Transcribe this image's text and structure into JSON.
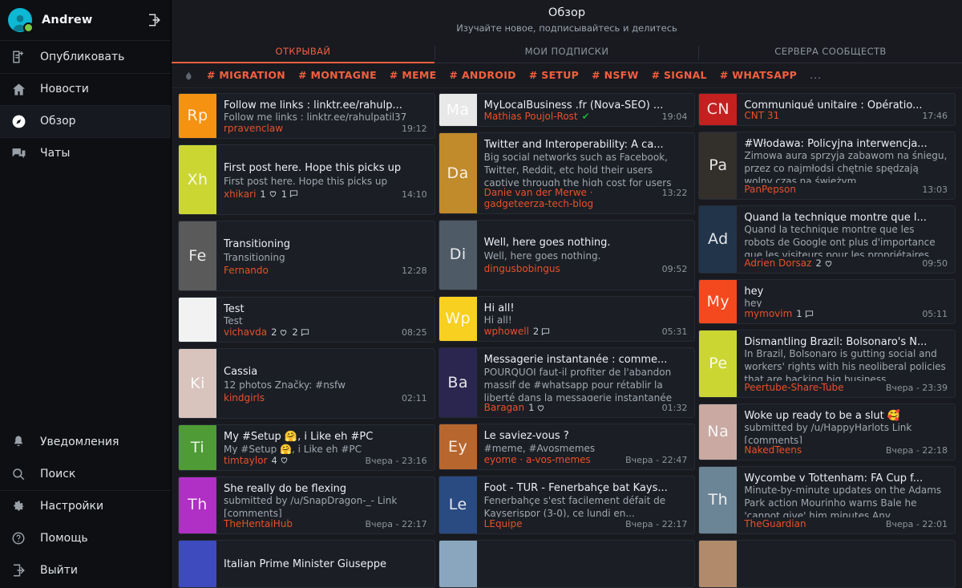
{
  "colors": {
    "accent": "#f4603e",
    "author": "#e8502a",
    "sidebar_bg": "#0d0f12",
    "card_bg": "#1b1e25",
    "verified": "#1ba83a"
  },
  "sidebar": {
    "user": {
      "name": "Andrew",
      "avatar_icon": "person-avatar",
      "status_icon": "online-dot",
      "logout_icon": "logout-icon"
    },
    "items_top": [
      {
        "label": "Опубликовать",
        "icon": "compose-icon",
        "active": false
      },
      {
        "label": "Новости",
        "icon": "home-icon",
        "active": false
      },
      {
        "label": "Обзор",
        "icon": "compass-icon",
        "active": true
      },
      {
        "label": "Чаты",
        "icon": "chat-icon",
        "active": false
      }
    ],
    "items_bottom": [
      {
        "label": "Уведомления",
        "icon": "bell-icon",
        "active": false
      },
      {
        "label": "Поиск",
        "icon": "search-icon",
        "active": false
      },
      {
        "label": "Настройки",
        "icon": "gear-icon",
        "active": false
      },
      {
        "label": "Помощь",
        "icon": "help-icon",
        "active": false
      },
      {
        "label": "Выйти",
        "icon": "logout-icon",
        "active": false
      }
    ]
  },
  "header": {
    "title": "Обзор",
    "subtitle": "Изучайте новое, подписывайтесь и делитесь",
    "tabs": [
      {
        "label": "ОТКРЫВАЙ",
        "active": true
      },
      {
        "label": "МОИ ПОДПИСКИ",
        "active": false
      },
      {
        "label": "СЕРВЕРА СООБЩЕСТВ",
        "active": false
      }
    ],
    "trending_icon": "fire-icon",
    "tags": [
      "# MIGRATION",
      "# MONTAGNE",
      "# MEME",
      "# ANDROID",
      "# SETUP",
      "# NSFW",
      "# SIGNAL",
      "# WHATSAPP"
    ],
    "tags_more": "..."
  },
  "columns": [
    [
      {
        "initials": "Rp",
        "color": "#f59211",
        "title": "Follow me links : linktr.ee/rahulp...",
        "subtitle": "Follow me links : linktr.ee/rahulpatil37",
        "author": "rpravenclaw",
        "time": "19:12",
        "likes": null,
        "comments": null,
        "verified": false,
        "wrap": false
      },
      {
        "initials": "Xh",
        "color": "#cbd633",
        "title": "First post here. Hope this picks up",
        "subtitle": "First post here. Hope this picks up",
        "author": "xhikari",
        "time": "14:10",
        "likes": "1",
        "comments": "1",
        "verified": false,
        "wrap": false,
        "tall": true
      },
      {
        "initials": "Fe",
        "color": "#5a5a5a",
        "title": "Transitioning",
        "subtitle": "Transitioning",
        "author": "Fernando",
        "time": "12:28",
        "likes": null,
        "comments": null,
        "verified": false,
        "wrap": false,
        "tall": true
      },
      {
        "initials": "",
        "color": "#f2f2f2",
        "title": "Test",
        "subtitle": "Test",
        "author": "vichavda",
        "time": "08:25",
        "likes": "2",
        "comments": "2",
        "verified": false,
        "wrap": false
      },
      {
        "initials": "Ki",
        "color": "#d8c3bd",
        "title": "Cassia",
        "subtitle": "12 photos Značky: #nsfw",
        "author": "kindgirls",
        "time": "02:11",
        "likes": null,
        "comments": null,
        "verified": false,
        "wrap": false,
        "tall": true
      },
      {
        "initials": "Ti",
        "color": "#4f9b36",
        "title": "My #Setup 🤗, i Like eh #PC",
        "subtitle": "My #Setup 🤗, i Like eh #PC",
        "author": "timtaylor",
        "time": "Вчера - 23:16",
        "likes": "4",
        "comments": null,
        "verified": false,
        "wrap": false
      },
      {
        "initials": "Th",
        "color": "#b02fc4",
        "title": "She really do be flexing",
        "subtitle": "submitted by /u/SnapDragon-_- Link [comments]",
        "author": "TheHentaiHub",
        "time": "Вчера - 22:17",
        "likes": null,
        "comments": null,
        "verified": false,
        "wrap": true
      },
      {
        "initials": "",
        "color": "#3d4bbf",
        "title": "Italian Prime Minister Giuseppe",
        "subtitle": "",
        "author": "",
        "time": "",
        "likes": null,
        "comments": null,
        "verified": false,
        "wrap": false,
        "partial": true
      }
    ],
    [
      {
        "initials": "Ma",
        "color": "#e8e8e8",
        "title": "MyLocalBusiness .fr (Nova-SEO) ...",
        "subtitle": "",
        "author": "Mathias Poujol-Rost",
        "time": "19:04",
        "likes": null,
        "comments": null,
        "verified": true,
        "wrap": false
      },
      {
        "initials": "Da",
        "color": "#c18a2a",
        "title": "Twitter and Interoperability: A ca...",
        "subtitle": "Big social networks such as Facebook, Twitter, Reddit, etc hold their users captive through the high cost for users",
        "author": "Danie van der Merwe · gadgeteerza-tech-blog",
        "time": "13:22",
        "likes": null,
        "comments": null,
        "verified": false,
        "wrap": true
      },
      {
        "initials": "Di",
        "color": "#4e5a66",
        "title": "Well, here goes nothing.",
        "subtitle": "Well, here goes nothing.",
        "author": "dingusbobingus",
        "time": "09:52",
        "likes": null,
        "comments": null,
        "verified": false,
        "wrap": false,
        "tall": true
      },
      {
        "initials": "Wp",
        "color": "#f7d020",
        "title": "Hi all!",
        "subtitle": "Hi all!",
        "author": "wphowell",
        "time": "05:31",
        "likes": null,
        "comments": "2",
        "verified": false,
        "wrap": false
      },
      {
        "initials": "Ba",
        "color": "#2b2650",
        "title": "Messagerie instantanée : comme...",
        "subtitle": "POURQUOI faut-il profiter de l'abandon massif de #whatsapp pour rétablir la liberté dans la messagerie instantanée",
        "author": "Baragan",
        "time": "01:32",
        "likes": "1",
        "comments": null,
        "verified": false,
        "wrap": true
      },
      {
        "initials": "Ey",
        "color": "#b7672e",
        "title": "Le saviez-vous ?",
        "subtitle": "#meme, #Avosmemes",
        "author": "eyome · a-vos-memes",
        "time": "Вчера - 22:47",
        "likes": null,
        "comments": null,
        "verified": false,
        "wrap": false
      },
      {
        "initials": "Le",
        "color": "#2a4a82",
        "title": "Foot - TUR - Fenerbahçe bat Kays...",
        "subtitle": "Fenerbahçe s'est facilement défait de Kayserispor (3-0), ce lundi en...",
        "author": "LEquipe",
        "time": "Вчера - 22:17",
        "likes": null,
        "comments": null,
        "verified": false,
        "wrap": true
      },
      {
        "initials": "",
        "color": "#8aa6bf",
        "title": "",
        "subtitle": "",
        "author": "",
        "time": "",
        "likes": null,
        "comments": null,
        "verified": false,
        "wrap": false,
        "partial": true
      }
    ],
    [
      {
        "initials": "CN",
        "color": "#c42020",
        "title": "Communiqué unitaire : Opératio...",
        "subtitle": "",
        "author": "CNT 31",
        "time": "17:46",
        "likes": null,
        "comments": null,
        "verified": false,
        "wrap": false
      },
      {
        "initials": "Pa",
        "color": "#33302c",
        "title": "#Włodawa: Policyjna interwencja...",
        "subtitle": "Zimowa aura sprzyja zabawom na śniegu, przez co najmłodsi chętnie spędzają wolny czas na świeżym",
        "author": "PanPepson",
        "time": "13:03",
        "likes": null,
        "comments": null,
        "verified": false,
        "wrap": true
      },
      {
        "initials": "Ad",
        "color": "#21344a",
        "title": "Quand la technique montre que l...",
        "subtitle": "Quand la technique montre que les robots de Google ont plus d'importance que les visiteurs pour les propriétaires",
        "author": "Adrien Dorsaz",
        "time": "09:50",
        "likes": "2",
        "comments": null,
        "verified": false,
        "wrap": true
      },
      {
        "initials": "My",
        "color": "#f4491e",
        "title": "hey",
        "subtitle": "hey",
        "author": "mymovim",
        "time": "05:11",
        "likes": null,
        "comments": "1",
        "verified": false,
        "wrap": false
      },
      {
        "initials": "Pe",
        "color": "#cbd633",
        "title": "Dismantling Brazil: Bolsonaro's N...",
        "subtitle": "In Brazil, Bolsonaro is gutting social and workers' rights with his neoliberal policies that are backing big business.",
        "author": "Peertube-Share-Tube",
        "time": "Вчера - 23:39",
        "likes": null,
        "comments": null,
        "verified": false,
        "wrap": true
      },
      {
        "initials": "Na",
        "color": "#c9a9a2",
        "title": "Woke up ready to be a slut 🥰",
        "subtitle": "submitted by /u/HappyHarlots Link [comments]",
        "author": "NakedTeens",
        "time": "Вчера - 22:18",
        "likes": null,
        "comments": null,
        "verified": false,
        "wrap": true
      },
      {
        "initials": "Th",
        "color": "#6b8596",
        "title": "Wycombe v Tottenham: FA Cup f...",
        "subtitle": "Minute-by-minute updates on the Adams Park action Mourinho warns Bale he 'cannot give' him minutes Any",
        "author": "TheGuardian",
        "time": "Вчера - 22:01",
        "likes": null,
        "comments": null,
        "verified": false,
        "wrap": true
      },
      {
        "initials": "",
        "color": "#b08a6a",
        "title": "",
        "subtitle": "",
        "author": "",
        "time": "",
        "likes": null,
        "comments": null,
        "verified": false,
        "wrap": false,
        "partial": true
      }
    ]
  ]
}
